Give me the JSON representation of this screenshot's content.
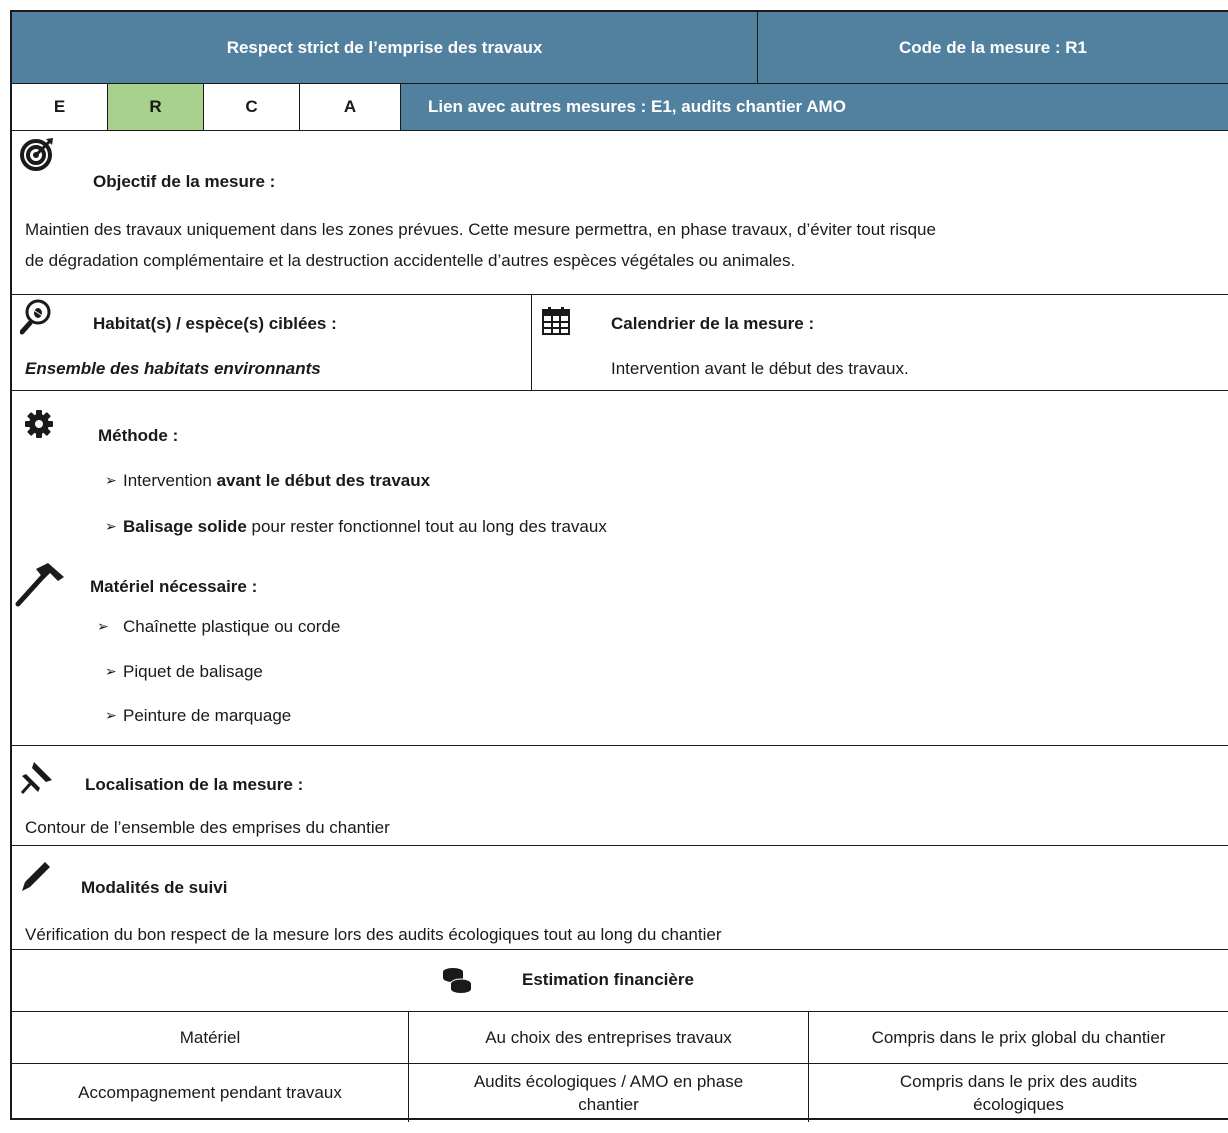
{
  "header": {
    "title": "Respect strict de l’emprise des travaux",
    "code": "Code de la mesure : R1"
  },
  "erca": {
    "letters": [
      "E",
      "R",
      "C",
      "A"
    ],
    "active": "R",
    "link": "Lien avec autres mesures : E1, audits chantier AMO"
  },
  "objective": {
    "icon": "target-icon",
    "title": "Objectif de la mesure :",
    "line1": "Maintien des travaux uniquement dans les zones prévues. Cette mesure permettra, en phase travaux, d’éviter tout risque",
    "line2": "de dégradation complémentaire et la destruction accidentelle d’autres espèces végétales ou animales."
  },
  "habitat": {
    "icon": "bug-magnifier-icon",
    "title": "Habitat(s) / espèce(s) ciblées :",
    "value": "Ensemble des habitats environnants"
  },
  "calendar": {
    "icon": "calendar-icon",
    "title": "Calendrier de la mesure :",
    "value": "Intervention avant le début des travaux."
  },
  "method": {
    "icon": "gear-icon",
    "title": "Méthode :",
    "items": [
      {
        "normal": "Intervention ",
        "bold": "avant le début des travaux",
        "after": ""
      },
      {
        "normal": "",
        "bold": "Balisage solide",
        "after": " pour rester fonctionnel tout au long des travaux"
      }
    ],
    "material_icon": "hammer-icon",
    "material_title": "Matériel nécessaire :",
    "materials": [
      "Chaînette plastique ou corde",
      "Piquet de balisage",
      "Peinture de marquage"
    ]
  },
  "location": {
    "icon": "pushpin-icon",
    "title": "Localisation de la mesure :",
    "value": "Contour de l’ensemble des emprises du chantier"
  },
  "monitoring": {
    "icon": "pencil-icon",
    "title": "Modalités de suivi",
    "value": "Vérification du bon respect de la mesure lors des audits écologiques tout au long du chantier"
  },
  "finance": {
    "icon": "coins-icon",
    "title": "Estimation financière",
    "rows": [
      [
        "Matériel",
        "Au choix des entreprises travaux",
        "Compris dans le prix global du chantier"
      ],
      [
        "Accompagnement pendant travaux",
        "Audits écologiques / AMO en phase chantier",
        "Compris dans le prix des audits écologiques"
      ]
    ]
  },
  "colors": {
    "header_blue": "#52809f",
    "active_green": "#a9d18e",
    "border": "#1a1a1a"
  }
}
